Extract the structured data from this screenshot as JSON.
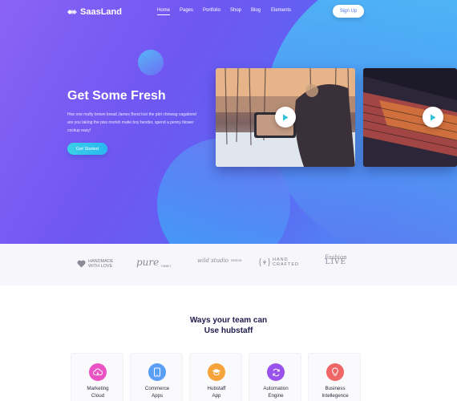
{
  "app": {
    "brand": "SaasLand"
  },
  "nav": {
    "items": [
      {
        "label": "Home",
        "active": true
      },
      {
        "label": "Pages",
        "active": false
      },
      {
        "label": "Portfolio",
        "active": false
      },
      {
        "label": "Shop",
        "active": false
      },
      {
        "label": "Blog",
        "active": false
      },
      {
        "label": "Elements",
        "active": false
      }
    ],
    "signup_label": "Sign Up"
  },
  "hero": {
    "title": "Get Some Fresh",
    "description": "Hoe one mufty brown bread James Bond lost the plot chinwag vagabond are you taking the piss morish matie boy bender, spend a penny blower cockup easy!",
    "cta_label": "Get Started",
    "videos": [
      {
        "name": "video-snow-phone",
        "play_icon": "play-icon"
      },
      {
        "name": "video-laptop",
        "play_icon": "play-icon"
      }
    ]
  },
  "brands": [
    {
      "line1": "HANDMADE",
      "line2": "WITH LOVE",
      "icon": "heart-icon"
    },
    {
      "main": "pure",
      "sub": "FAMILY"
    },
    {
      "main": "wild studio",
      "sub": "DESIGN"
    },
    {
      "main": "HAND",
      "sub": "CRAFTED",
      "icon": "leaf-icon"
    },
    {
      "main": "Fashion",
      "sub": "LIVE"
    }
  ],
  "section": {
    "title_line1": "Ways your team can",
    "title_line2": "Use hubstaff",
    "features": [
      {
        "line1": "Marketing",
        "line2": "Cloud",
        "icon": "cloud-icon",
        "color": "#e953c3"
      },
      {
        "line1": "Commerce",
        "line2": "Apps",
        "icon": "tablet-icon",
        "color": "#5a9ef5"
      },
      {
        "line1": "Hubstaff",
        "line2": "App",
        "icon": "graduation-cap-icon",
        "color": "#f5a33a"
      },
      {
        "line1": "Automation",
        "line2": "Engine",
        "icon": "refresh-icon",
        "color": "#9a52ec"
      },
      {
        "line1": "Business",
        "line2": "Intellegence",
        "icon": "lightbulb-icon",
        "color": "#f06565"
      }
    ]
  },
  "colors": {
    "accent": "#4e74f4",
    "cta": "#2bbfef",
    "heading": "#1f1b4d"
  }
}
